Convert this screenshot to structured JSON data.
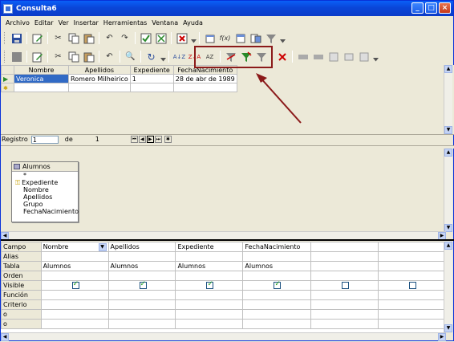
{
  "window": {
    "title": "Consulta6"
  },
  "menu": [
    "Archivo",
    "Editar",
    "Ver",
    "Insertar",
    "Herramientas",
    "Ventana",
    "Ayuda"
  ],
  "grid": {
    "headers": [
      "Nombre",
      "Apellidos",
      "Expediente",
      "FechaNacimiento"
    ],
    "rows": [
      [
        "Veronica",
        "Romero Milheirico",
        "1",
        "28 de abr de 1989"
      ]
    ]
  },
  "nav": {
    "registro_label": "Registro",
    "record_value": "1",
    "de_label": "de",
    "total": "1"
  },
  "table": {
    "title": "Alumnos",
    "fields": [
      "*",
      "Expediente",
      "Nombre",
      "Apellidos",
      "Grupo",
      "FechaNacimiento"
    ]
  },
  "criteria": {
    "row_labels": [
      "Campo",
      "Alias",
      "Tabla",
      "Orden",
      "Visible",
      "Función",
      "Criterio",
      "o",
      "o"
    ],
    "campo": [
      "Nombre",
      "Apellidos",
      "Expediente",
      "FechaNacimiento",
      "",
      ""
    ],
    "tabla": [
      "Alumnos",
      "Alumnos",
      "Alumnos",
      "Alumnos",
      "",
      ""
    ]
  },
  "colors": {
    "highlight_box": "#8b1a1a",
    "selection": "#316ac5",
    "title_bar": "#0a46d8"
  }
}
